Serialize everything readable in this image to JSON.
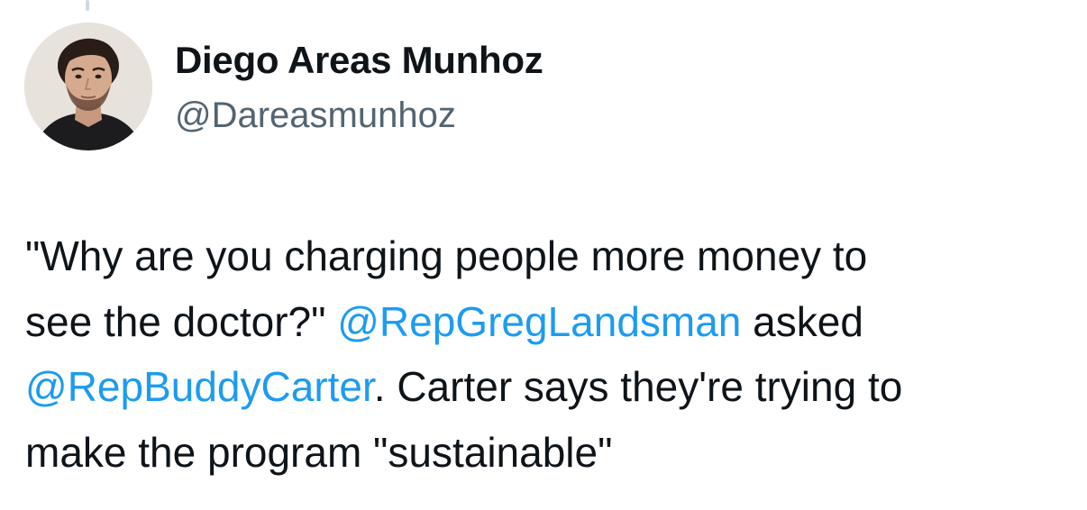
{
  "author": {
    "display_name": "Diego Areas Munhoz",
    "handle": "@Dareasmunhoz",
    "avatar_icon": "profile-photo"
  },
  "tweet": {
    "line1": "\"Why are you charging people more money to",
    "line2_pre": "see the doctor?\" ",
    "mention1": "@RepGregLandsman",
    "line2_post": " asked",
    "mention2": "@RepBuddyCarter",
    "line3_post": ". Carter says they're trying to",
    "line4": "make the program \"sustainable\""
  },
  "colors": {
    "text": "#0f1419",
    "secondary": "#536471",
    "link": "#1d9bf0",
    "thread_line": "#cfd9de"
  }
}
